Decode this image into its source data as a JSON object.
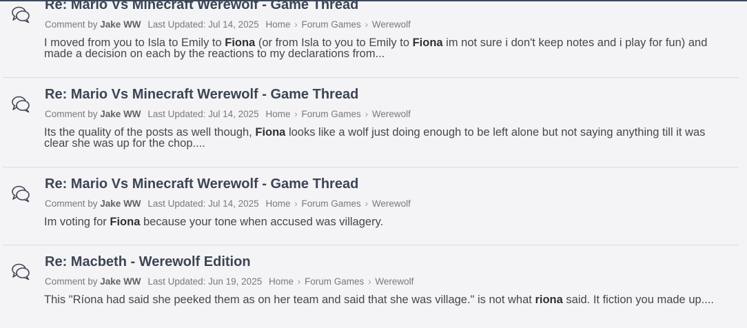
{
  "results": [
    {
      "title": "Re: Mario Vs Minecraft Werewolf - Game Thread",
      "prefix": "Comment by",
      "author": "Jake WW",
      "updated": "Last Updated: Jul 14, 2025",
      "crumbs": [
        "Home",
        "Forum Games",
        "Werewolf"
      ],
      "snippet": [
        {
          "t": "I moved from you to Isla to Emily to "
        },
        {
          "t": "Fiona",
          "b": true
        },
        {
          "t": " (or from Isla to you to Emily to "
        },
        {
          "t": "Fiona",
          "b": true
        },
        {
          "t": " im not sure i don't keep notes and i play for fun) and made a decision on each by the reactions to my declarations from..."
        }
      ]
    },
    {
      "title": "Re: Mario Vs Minecraft Werewolf - Game Thread",
      "prefix": "Comment by",
      "author": "Jake WW",
      "updated": "Last Updated: Jul 14, 2025",
      "crumbs": [
        "Home",
        "Forum Games",
        "Werewolf"
      ],
      "snippet": [
        {
          "t": "Its the quality of the posts as well though, "
        },
        {
          "t": "Fiona",
          "b": true
        },
        {
          "t": " looks like a wolf just doing enough to be left alone but not saying anything till it was clear she was up for the chop...."
        }
      ]
    },
    {
      "title": "Re: Mario Vs Minecraft Werewolf - Game Thread",
      "prefix": "Comment by",
      "author": "Jake WW",
      "updated": "Last Updated: Jul 14, 2025",
      "crumbs": [
        "Home",
        "Forum Games",
        "Werewolf"
      ],
      "snippet": [
        {
          "t": "Im voting for "
        },
        {
          "t": "Fiona",
          "b": true
        },
        {
          "t": " because your tone when accused was villagery."
        }
      ]
    },
    {
      "title": "Re: Macbeth - Werewolf Edition",
      "prefix": "Comment by",
      "author": "Jake WW",
      "updated": "Last Updated: Jun 19, 2025",
      "crumbs": [
        "Home",
        "Forum Games",
        "Werewolf"
      ],
      "snippet": [
        {
          "t": "This \"Ríona had said she peeked them as on her team and said that she was village.\" is not what "
        },
        {
          "t": "riona",
          "b": true
        },
        {
          "t": " said. It fiction you made up...."
        }
      ]
    }
  ],
  "breadcrumb_separator": "›",
  "icon": "chat-bubbles-icon"
}
